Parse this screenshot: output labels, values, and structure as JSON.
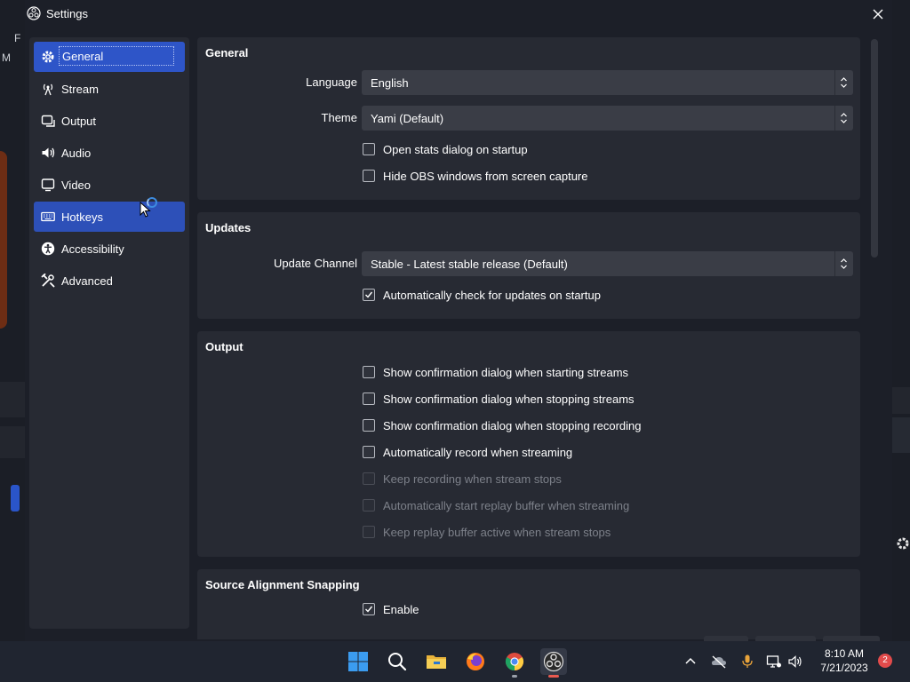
{
  "window": {
    "title": "Settings"
  },
  "background_app": {
    "letter_f": "F",
    "letter_m": "M"
  },
  "sidebar": {
    "items": [
      {
        "label": "General",
        "icon": "gear-icon"
      },
      {
        "label": "Stream",
        "icon": "antenna-icon"
      },
      {
        "label": "Output",
        "icon": "output-icon"
      },
      {
        "label": "Audio",
        "icon": "speaker-icon"
      },
      {
        "label": "Video",
        "icon": "monitor-icon"
      },
      {
        "label": "Hotkeys",
        "icon": "keyboard-icon"
      },
      {
        "label": "Accessibility",
        "icon": "accessibility-icon"
      },
      {
        "label": "Advanced",
        "icon": "tools-icon"
      }
    ],
    "selected": "General",
    "hovered": "Hotkeys"
  },
  "general": {
    "title": "General",
    "language_label": "Language",
    "language_value": "English",
    "theme_label": "Theme",
    "theme_value": "Yami (Default)",
    "open_stats": {
      "label": "Open stats dialog on startup",
      "checked": false
    },
    "hide_obs": {
      "label": "Hide OBS windows from screen capture",
      "checked": false
    }
  },
  "updates": {
    "title": "Updates",
    "channel_label": "Update Channel",
    "channel_value": "Stable - Latest stable release (Default)",
    "auto_check": {
      "label": "Automatically check for updates on startup",
      "checked": true
    }
  },
  "output": {
    "title": "Output",
    "options": [
      {
        "label": "Show confirmation dialog when starting streams",
        "checked": false,
        "enabled": true
      },
      {
        "label": "Show confirmation dialog when stopping streams",
        "checked": false,
        "enabled": true
      },
      {
        "label": "Show confirmation dialog when stopping recording",
        "checked": false,
        "enabled": true
      },
      {
        "label": "Automatically record when streaming",
        "checked": false,
        "enabled": true
      },
      {
        "label": "Keep recording when stream stops",
        "checked": false,
        "enabled": false
      },
      {
        "label": "Automatically start replay buffer when streaming",
        "checked": false,
        "enabled": false
      },
      {
        "label": "Keep replay buffer active when stream stops",
        "checked": false,
        "enabled": false
      }
    ]
  },
  "snapping": {
    "title": "Source Alignment Snapping",
    "enable": {
      "label": "Enable",
      "checked": true
    }
  },
  "taskbar": {
    "time": "8:10 AM",
    "date": "7/21/2023",
    "notification_count": "2",
    "apps": [
      "start-icon",
      "search-icon",
      "file-explorer-icon",
      "firefox-icon",
      "chrome-icon",
      "obs-icon"
    ]
  },
  "colors": {
    "accent": "#2e55c8",
    "panel": "#272a33",
    "window": "#1c1f28",
    "input": "#3a3d46"
  }
}
